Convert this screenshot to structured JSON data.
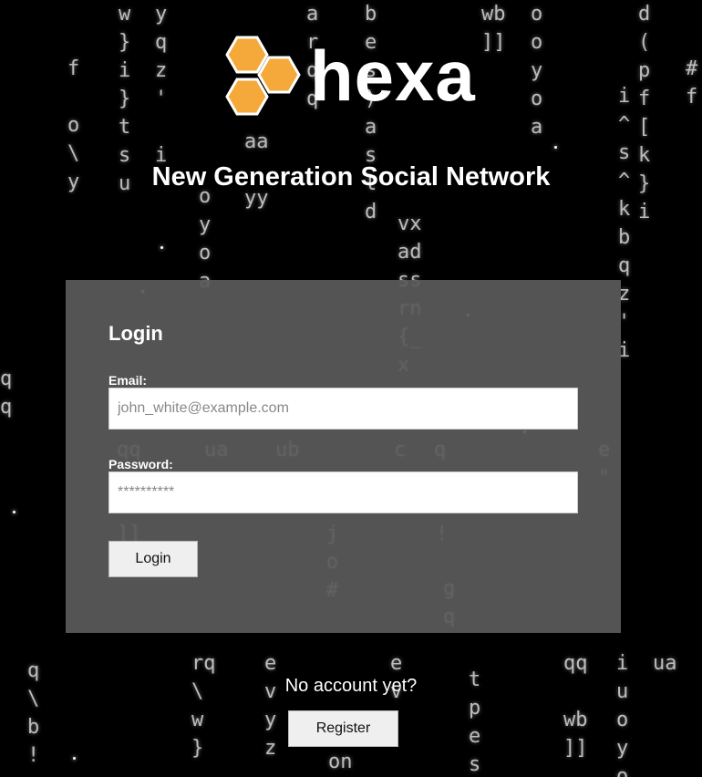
{
  "brand": {
    "logo_text": "hexa",
    "logo_icon": "hexagon-cluster-icon",
    "accent_color": "#F5A93A"
  },
  "tagline": "New Generation Social Network",
  "login_form": {
    "title": "Login",
    "email_label": "Email:",
    "email_placeholder": "john_white@example.com",
    "password_label": "Password:",
    "password_placeholder": "**********",
    "submit_label": "Login"
  },
  "signup": {
    "prompt": "No account yet?",
    "register_label": "Register"
  }
}
